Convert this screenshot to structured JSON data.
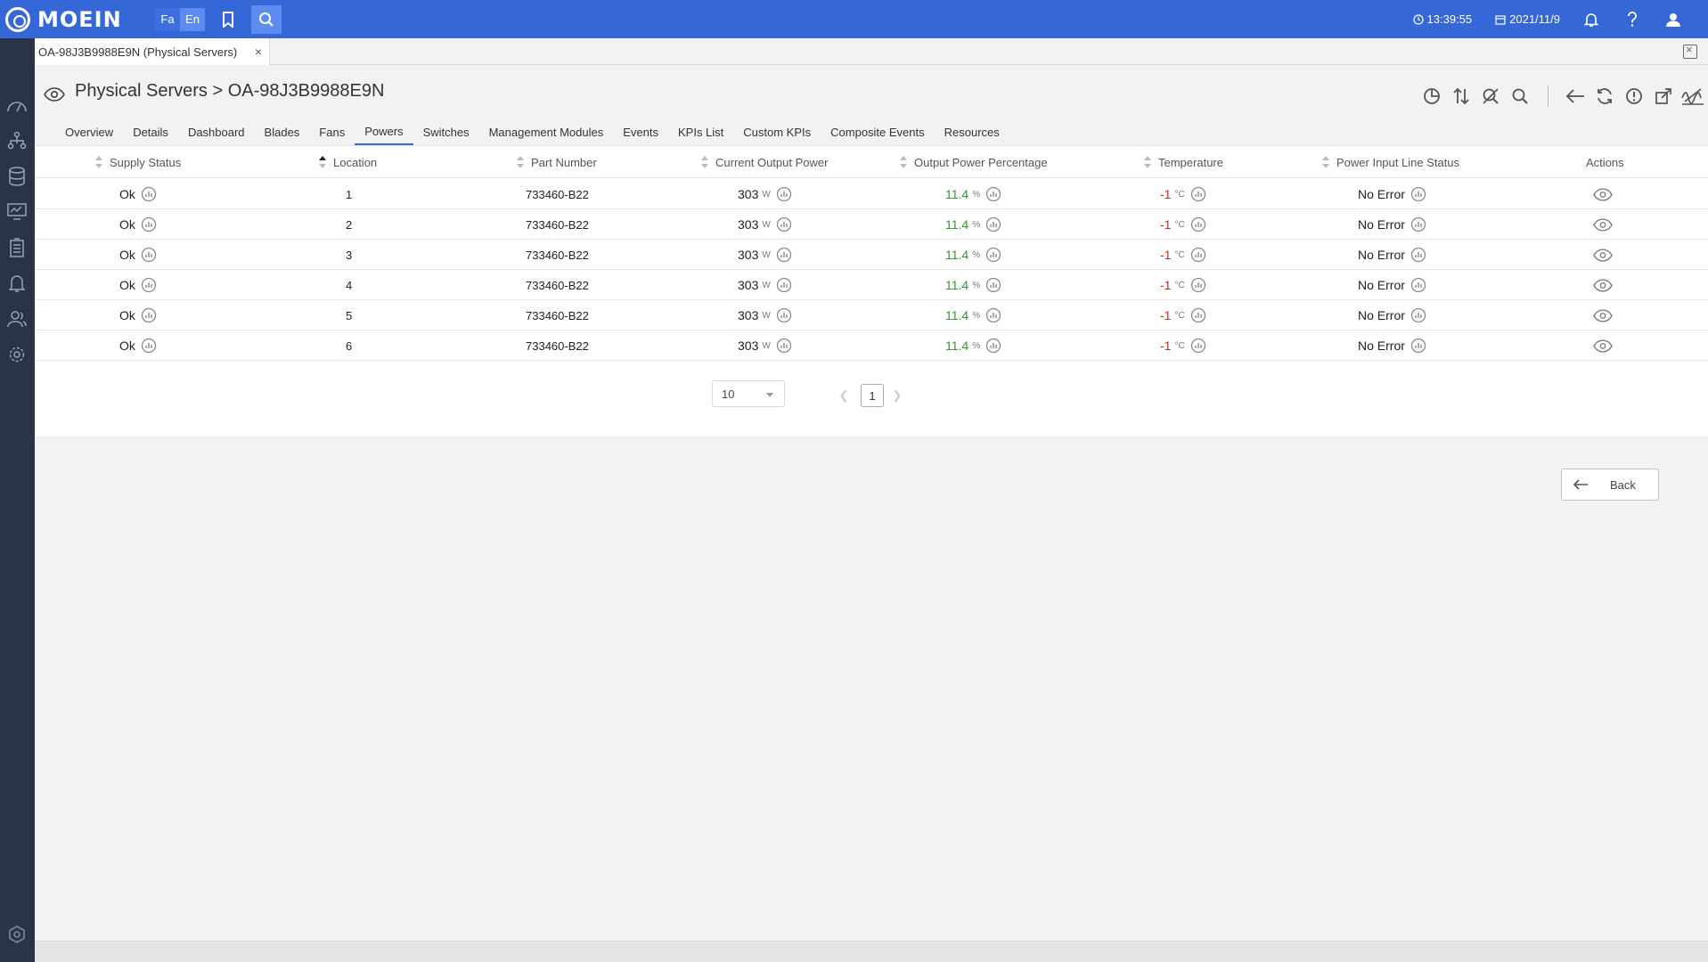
{
  "topbar": {
    "logo": "MOEIN",
    "lang_fa": "Fa",
    "lang_en": "En",
    "time": "13:39:55",
    "date": "2021/11/9",
    "brand_color": "#3667d6"
  },
  "doc_tab": {
    "label": "OA-98J3B9988E9N (Physical Servers)",
    "close": "×"
  },
  "header": {
    "title": "Physical Servers > OA-98J3B9988E9N"
  },
  "tabs": [
    "Overview",
    "Details",
    "Dashboard",
    "Blades",
    "Fans",
    "Powers",
    "Switches",
    "Management Modules",
    "Events",
    "KPIs List",
    "Custom KPIs",
    "Composite Events",
    "Resources"
  ],
  "active_tab": "Powers",
  "table": {
    "columns": [
      "Supply Status",
      "Location",
      "Part Number",
      "Current Output Power",
      "Output Power Percentage",
      "Temperature",
      "Power Input Line Status",
      "Actions"
    ],
    "rows": [
      {
        "status": "Ok",
        "location": "1",
        "part": "733460-B22",
        "power": "303",
        "power_unit": "W",
        "percent": "11.4",
        "percent_unit": "%",
        "temp": "-1",
        "temp_unit": "°C",
        "line": "No Error"
      },
      {
        "status": "Ok",
        "location": "2",
        "part": "733460-B22",
        "power": "303",
        "power_unit": "W",
        "percent": "11.4",
        "percent_unit": "%",
        "temp": "-1",
        "temp_unit": "°C",
        "line": "No Error"
      },
      {
        "status": "Ok",
        "location": "3",
        "part": "733460-B22",
        "power": "303",
        "power_unit": "W",
        "percent": "11.4",
        "percent_unit": "%",
        "temp": "-1",
        "temp_unit": "°C",
        "line": "No Error"
      },
      {
        "status": "Ok",
        "location": "4",
        "part": "733460-B22",
        "power": "303",
        "power_unit": "W",
        "percent": "11.4",
        "percent_unit": "%",
        "temp": "-1",
        "temp_unit": "°C",
        "line": "No Error"
      },
      {
        "status": "Ok",
        "location": "5",
        "part": "733460-B22",
        "power": "303",
        "power_unit": "W",
        "percent": "11.4",
        "percent_unit": "%",
        "temp": "-1",
        "temp_unit": "°C",
        "line": "No Error"
      },
      {
        "status": "Ok",
        "location": "6",
        "part": "733460-B22",
        "power": "303",
        "power_unit": "W",
        "percent": "11.4",
        "percent_unit": "%",
        "temp": "-1",
        "temp_unit": "°C",
        "line": "No Error"
      }
    ]
  },
  "pagination": {
    "page_size": "10",
    "current_page": "1"
  },
  "back_button": {
    "label": "Back"
  }
}
